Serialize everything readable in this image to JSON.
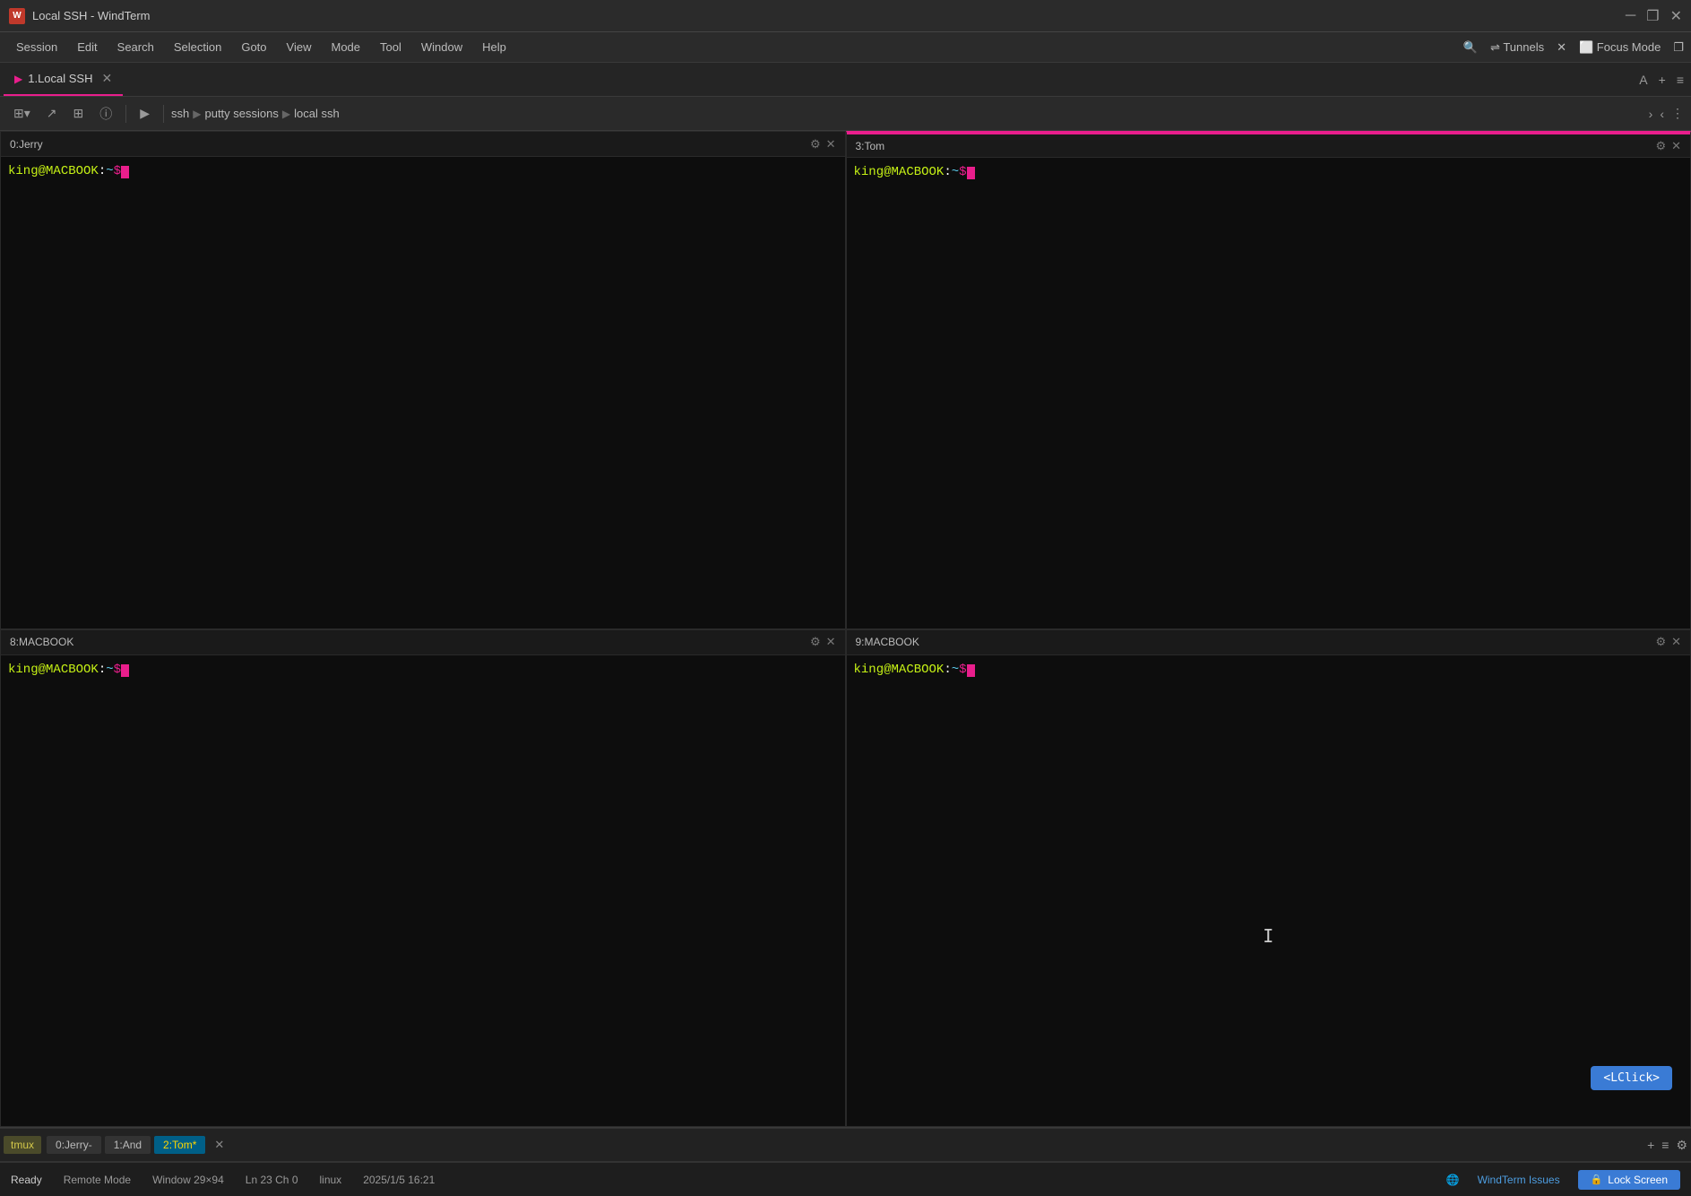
{
  "app": {
    "title": "Local SSH - WindTerm",
    "icon_label": "W"
  },
  "title_bar": {
    "title": "Local SSH - WindTerm",
    "minimize_label": "─",
    "restore_label": "❐",
    "close_label": "✕"
  },
  "menu_bar": {
    "items": [
      {
        "id": "session",
        "label": "Session"
      },
      {
        "id": "edit",
        "label": "Edit"
      },
      {
        "id": "search",
        "label": "Search"
      },
      {
        "id": "selection",
        "label": "Selection"
      },
      {
        "id": "goto",
        "label": "Goto"
      },
      {
        "id": "view",
        "label": "View"
      },
      {
        "id": "mode",
        "label": "Mode"
      },
      {
        "id": "tool",
        "label": "Tool"
      },
      {
        "id": "window",
        "label": "Window"
      },
      {
        "id": "help",
        "label": "Help"
      }
    ],
    "right_actions": [
      {
        "id": "search-icon",
        "label": "🔍"
      },
      {
        "id": "tunnels",
        "label": "⇌ Tunnels"
      },
      {
        "id": "close-x",
        "label": "✕"
      },
      {
        "id": "focus-mode",
        "label": "⬜ Focus Mode"
      },
      {
        "id": "restore",
        "label": "❐"
      }
    ]
  },
  "tab_bar": {
    "tabs": [
      {
        "id": "local-ssh",
        "label": "1.Local SSH",
        "active": true
      }
    ],
    "right_controls": [
      "A",
      "+",
      "≡"
    ]
  },
  "toolbar": {
    "buttons": [
      "⊞▾",
      "↗",
      "⊞",
      "ⓘ",
      "▶"
    ],
    "breadcrumb": [
      "ssh",
      "putty sessions",
      "local ssh"
    ],
    "right_controls": [
      "›",
      "‹",
      "⋮"
    ]
  },
  "panes": [
    {
      "id": "pane-jerry",
      "index": "0",
      "title": "Jerry",
      "active": false,
      "prompt": "king@MACBOOK:~$",
      "user": "king",
      "host": "MACBOOK",
      "path": "~",
      "position": "top-left"
    },
    {
      "id": "pane-tom",
      "index": "3",
      "title": "Tom",
      "active": true,
      "prompt": "king@MACBOOK:~$",
      "user": "king",
      "host": "MACBOOK",
      "path": "~",
      "position": "top-right"
    },
    {
      "id": "pane-macbook-8",
      "index": "8",
      "title": "MACBOOK",
      "active": false,
      "prompt": "king@MACBOOK:~$",
      "user": "king",
      "host": "MACBOOK",
      "path": "~",
      "position": "bottom-left"
    },
    {
      "id": "pane-macbook-9",
      "index": "9",
      "title": "MACBOOK",
      "active": false,
      "prompt": "king@MACBOOK:~$",
      "user": "king",
      "host": "MACBOOK",
      "path": "~",
      "position": "bottom-right",
      "has_click_indicator": true,
      "click_indicator": "<LClick>",
      "has_cursor": true
    }
  ],
  "tmux_bar": {
    "icon_label": "tmux",
    "tabs": [
      {
        "id": "tab-jerry",
        "label": "0:Jerry-",
        "active": false
      },
      {
        "id": "tab-and",
        "label": "1:And",
        "active": false
      },
      {
        "id": "tab-tom",
        "label": "2:Tom*",
        "active": true,
        "modified": true
      }
    ],
    "close_label": "✕",
    "right_controls": [
      "+",
      "≡",
      "⚙"
    ]
  },
  "status_bar": {
    "ready": "Ready",
    "remote_mode": "Remote Mode",
    "window_size": "Window 29×94",
    "ln_ch": "Ln 23 Ch 0",
    "os": "linux",
    "datetime": "2025/1/5 16:21",
    "windterm_issues": "WindTerm Issues",
    "lock_screen": "Lock Screen"
  },
  "colors": {
    "accent_pink": "#e91e8c",
    "accent_blue": "#3a7bd5",
    "prompt_green": "#c5f015",
    "prompt_cyan": "#5bc8e8",
    "active_pane_border": "#e91e8c",
    "windterm_blue": "#4d9de0"
  }
}
